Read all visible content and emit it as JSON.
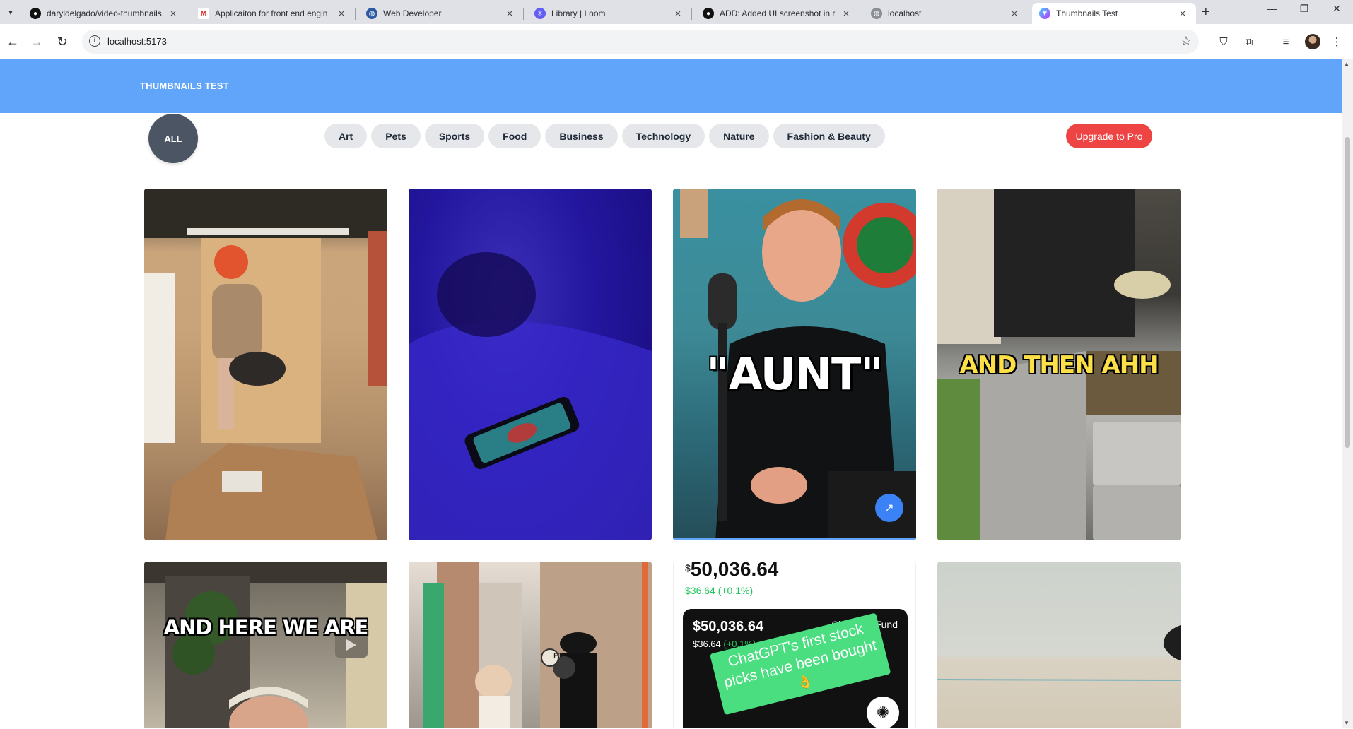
{
  "browser": {
    "tabs": [
      {
        "title": "daryldelgado/video-thumbnails",
        "favicon": "github-icon",
        "active": false
      },
      {
        "title": "Applicaiton for front end engin",
        "favicon": "gmail-icon",
        "active": false
      },
      {
        "title": "Web Developer",
        "favicon": "globe-icon",
        "active": false
      },
      {
        "title": "Library | Loom",
        "favicon": "loom-icon",
        "active": false
      },
      {
        "title": "ADD: Added UI screenshot in r",
        "favicon": "github-icon",
        "active": false
      },
      {
        "title": "localhost",
        "favicon": "globe-icon",
        "active": false
      },
      {
        "title": "Thumbnails Test",
        "favicon": "vite-icon",
        "active": true
      }
    ],
    "url": "localhost:5173"
  },
  "header": {
    "brand": "THUMBNAILS TEST",
    "color": "#60a5fa"
  },
  "filters": {
    "all_label": "ALL",
    "categories": [
      "Art",
      "Pets",
      "Sports",
      "Food",
      "Business",
      "Technology",
      "Nature",
      "Fashion & Beauty"
    ],
    "upgrade_label": "Upgrade to Pro"
  },
  "thumbnails": {
    "row1": [
      {
        "caption": "",
        "scene": "man-opening-box"
      },
      {
        "caption": "",
        "scene": "phone-on-bed-blue"
      },
      {
        "caption": "\"AUNT\"",
        "scene": "podcast-host",
        "hovered": true
      },
      {
        "caption": "AND THEN AHH",
        "scene": "salad-counter"
      }
    ],
    "row2": [
      {
        "caption": "AND HERE WE ARE",
        "scene": "office-plant"
      },
      {
        "caption": "",
        "scene": "street-interview",
        "badge": "FIT"
      },
      {
        "caption": "",
        "scene": "chatgpt-fund"
      },
      {
        "caption": "",
        "scene": "blank-wall"
      }
    ]
  },
  "fund_card": {
    "top_dollar_sign": "$",
    "top_value": "50,036.64",
    "top_change": "$36.64 (+0.1%)",
    "panel_value": "$50,036.64",
    "panel_change_amount": "$36.64",
    "panel_change_pct": "(+0.1%)",
    "panel_title": "ChatGPT Fund",
    "banner_line1": "ChatGPT's first stock",
    "banner_line2": "picks have been bought",
    "banner_emoji": "👌"
  },
  "colors": {
    "accent": "#60a5fa",
    "all_button": "#4b5563",
    "upgrade": "#ef4444",
    "chip": "#e5e7eb",
    "fund_green": "#22c55e"
  }
}
